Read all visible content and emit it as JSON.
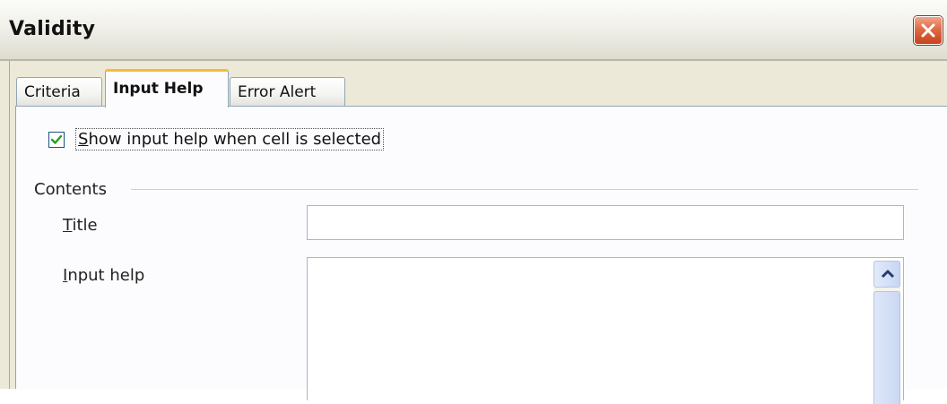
{
  "window": {
    "title": "Validity",
    "close_icon": "close-icon"
  },
  "tabs": [
    {
      "label": "Criteria",
      "active": false
    },
    {
      "label": "Input Help",
      "active": true
    },
    {
      "label": "Error Alert",
      "active": false
    }
  ],
  "input_help": {
    "show_checkbox": {
      "checked": true,
      "label_mnemonic": "S",
      "label_rest": "how input help when cell is selected"
    },
    "contents_group": "Contents",
    "title_field": {
      "label_mnemonic": "T",
      "label_rest": "itle",
      "value": ""
    },
    "input_help_field": {
      "label_mnemonic": "I",
      "label_rest": "nput help",
      "value": ""
    }
  },
  "colors": {
    "active_tab_accent": "#f8b93b",
    "close_button": "#e06a44",
    "checkmark": "#21a121"
  }
}
